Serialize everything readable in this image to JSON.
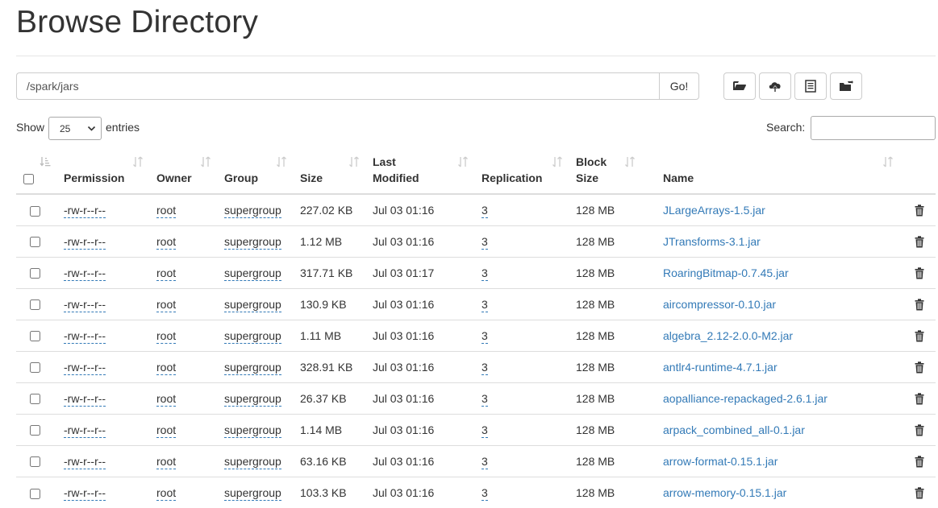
{
  "page": {
    "title": "Browse Directory"
  },
  "path_bar": {
    "value": "/spark/jars",
    "go_label": "Go!"
  },
  "toolbar": {
    "buttons": [
      {
        "icon": "folder-open-icon"
      },
      {
        "icon": "cloud-upload-icon"
      },
      {
        "icon": "list-icon"
      },
      {
        "icon": "folder-move-icon"
      }
    ]
  },
  "table_controls": {
    "show_label": "Show",
    "entries_value": "25",
    "entries_label": "entries",
    "search_label": "Search:",
    "search_value": ""
  },
  "table": {
    "columns": [
      "",
      "Permission",
      "Owner",
      "Group",
      "Size",
      "Last Modified",
      "Replication",
      "Block Size",
      "Name",
      ""
    ],
    "rows": [
      {
        "permission": "-rw-r--r--",
        "owner": "root",
        "group": "supergroup",
        "size": "227.02 KB",
        "modified": "Jul 03 01:16",
        "replication": "3",
        "block_size": "128 MB",
        "name": "JLargeArrays-1.5.jar"
      },
      {
        "permission": "-rw-r--r--",
        "owner": "root",
        "group": "supergroup",
        "size": "1.12 MB",
        "modified": "Jul 03 01:16",
        "replication": "3",
        "block_size": "128 MB",
        "name": "JTransforms-3.1.jar"
      },
      {
        "permission": "-rw-r--r--",
        "owner": "root",
        "group": "supergroup",
        "size": "317.71 KB",
        "modified": "Jul 03 01:17",
        "replication": "3",
        "block_size": "128 MB",
        "name": "RoaringBitmap-0.7.45.jar"
      },
      {
        "permission": "-rw-r--r--",
        "owner": "root",
        "group": "supergroup",
        "size": "130.9 KB",
        "modified": "Jul 03 01:16",
        "replication": "3",
        "block_size": "128 MB",
        "name": "aircompressor-0.10.jar"
      },
      {
        "permission": "-rw-r--r--",
        "owner": "root",
        "group": "supergroup",
        "size": "1.11 MB",
        "modified": "Jul 03 01:16",
        "replication": "3",
        "block_size": "128 MB",
        "name": "algebra_2.12-2.0.0-M2.jar"
      },
      {
        "permission": "-rw-r--r--",
        "owner": "root",
        "group": "supergroup",
        "size": "328.91 KB",
        "modified": "Jul 03 01:16",
        "replication": "3",
        "block_size": "128 MB",
        "name": "antlr4-runtime-4.7.1.jar"
      },
      {
        "permission": "-rw-r--r--",
        "owner": "root",
        "group": "supergroup",
        "size": "26.37 KB",
        "modified": "Jul 03 01:16",
        "replication": "3",
        "block_size": "128 MB",
        "name": "aopalliance-repackaged-2.6.1.jar"
      },
      {
        "permission": "-rw-r--r--",
        "owner": "root",
        "group": "supergroup",
        "size": "1.14 MB",
        "modified": "Jul 03 01:16",
        "replication": "3",
        "block_size": "128 MB",
        "name": "arpack_combined_all-0.1.jar"
      },
      {
        "permission": "-rw-r--r--",
        "owner": "root",
        "group": "supergroup",
        "size": "63.16 KB",
        "modified": "Jul 03 01:16",
        "replication": "3",
        "block_size": "128 MB",
        "name": "arrow-format-0.15.1.jar"
      },
      {
        "permission": "-rw-r--r--",
        "owner": "root",
        "group": "supergroup",
        "size": "103.3 KB",
        "modified": "Jul 03 01:16",
        "replication": "3",
        "block_size": "128 MB",
        "name": "arrow-memory-0.15.1.jar"
      }
    ]
  },
  "colors": {
    "link": "#337ab7",
    "text": "#333333",
    "border": "#dddddd"
  }
}
